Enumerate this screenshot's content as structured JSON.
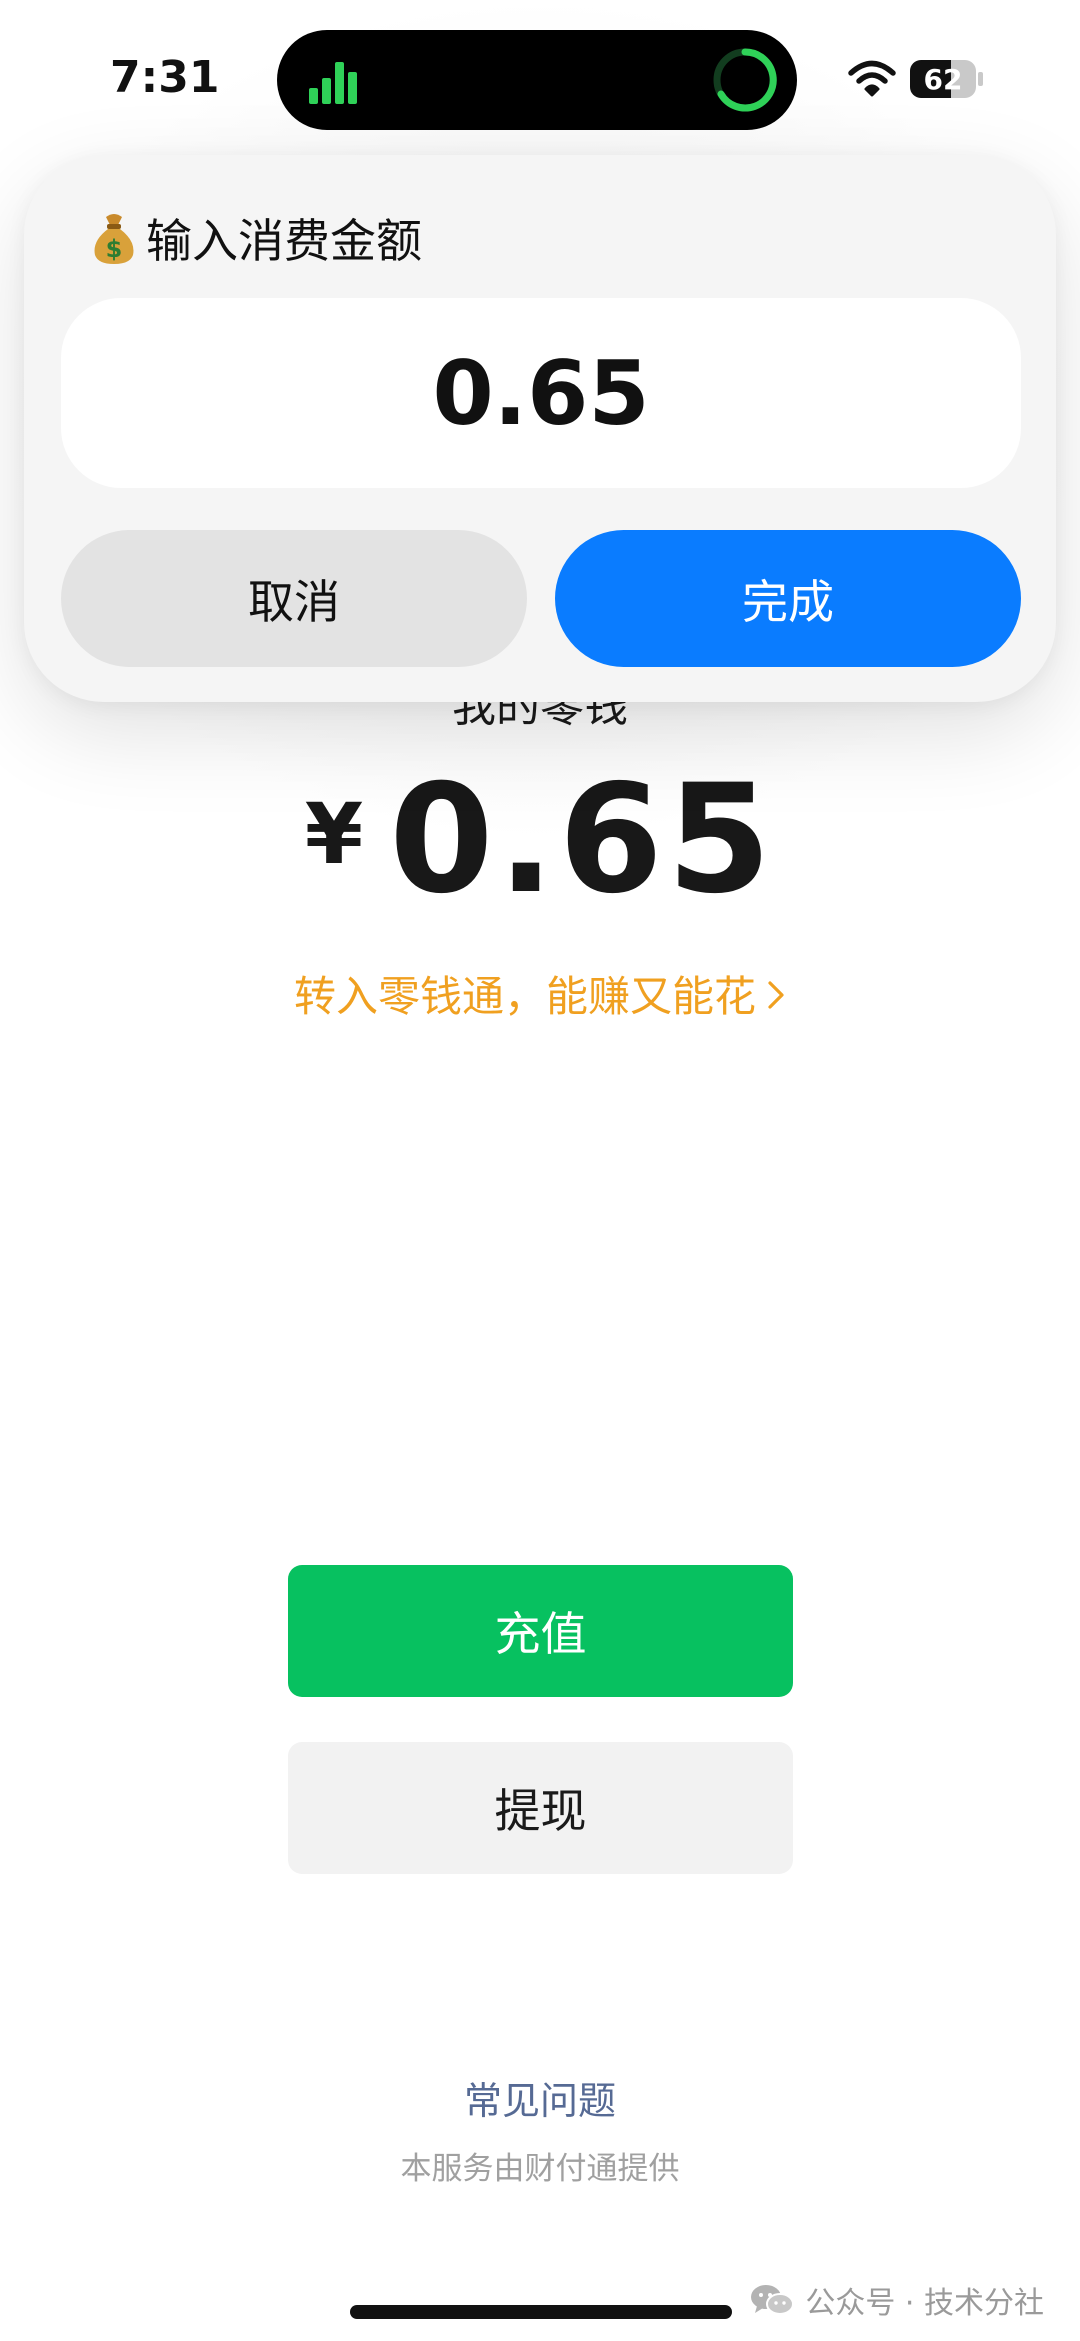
{
  "status_bar": {
    "time": "7:31",
    "battery_percent": "62",
    "battery_level": 0.62
  },
  "dialog": {
    "title": "输入消费金额",
    "title_icon": "money-bag-icon",
    "amount_value": "0.65",
    "cancel_label": "取消",
    "done_label": "完成",
    "done_color": "#0a7cff"
  },
  "wallet": {
    "title": "我的零钱",
    "currency_symbol": "¥",
    "balance": "0.65",
    "promo_text": "转入零钱通，能赚又能花",
    "promo_color": "#f0a020",
    "recharge_label": "充值",
    "recharge_color": "#07c160",
    "withdraw_label": "提现",
    "faq_link": "常见问题",
    "provider_text": "本服务由财付通提供"
  },
  "watermark": {
    "text": "公众号 · 技术分社",
    "icon": "wechat-icon"
  }
}
